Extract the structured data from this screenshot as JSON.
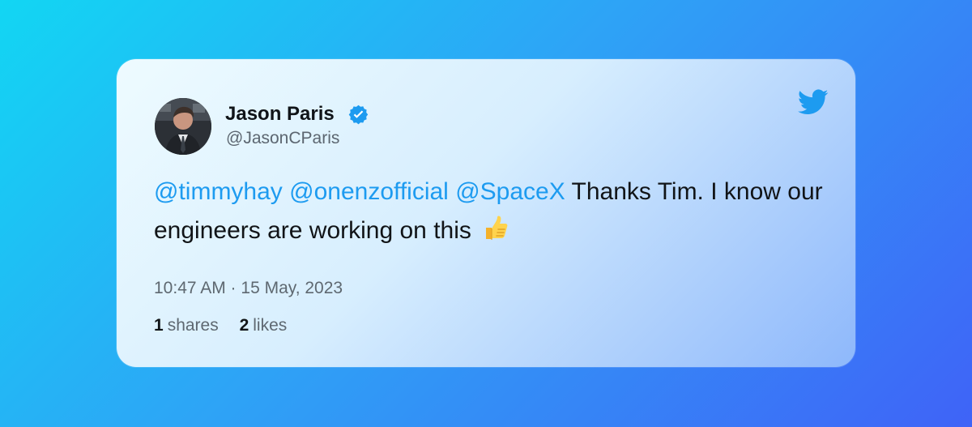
{
  "tweet": {
    "author": {
      "name": "Jason Paris",
      "handle": "@JasonCParis",
      "verified": true,
      "avatar_icon": "avatar-photo"
    },
    "mentions": [
      "@timmyhay",
      "@onenzofficial",
      "@SpaceX"
    ],
    "text": "Thanks Tim. I know our engineers are working on this",
    "emoji_icon": "thumbs-up-icon",
    "timestamp": "10:47 AM · 15 May, 2023",
    "stats": {
      "shares": {
        "count": "1",
        "label": "shares"
      },
      "likes": {
        "count": "2",
        "label": "likes"
      }
    },
    "brand_icon": "twitter-bird-icon"
  },
  "colors": {
    "accent": "#1d9bf0",
    "background_start": "#12d6f3",
    "background_end": "#3f63f7"
  }
}
